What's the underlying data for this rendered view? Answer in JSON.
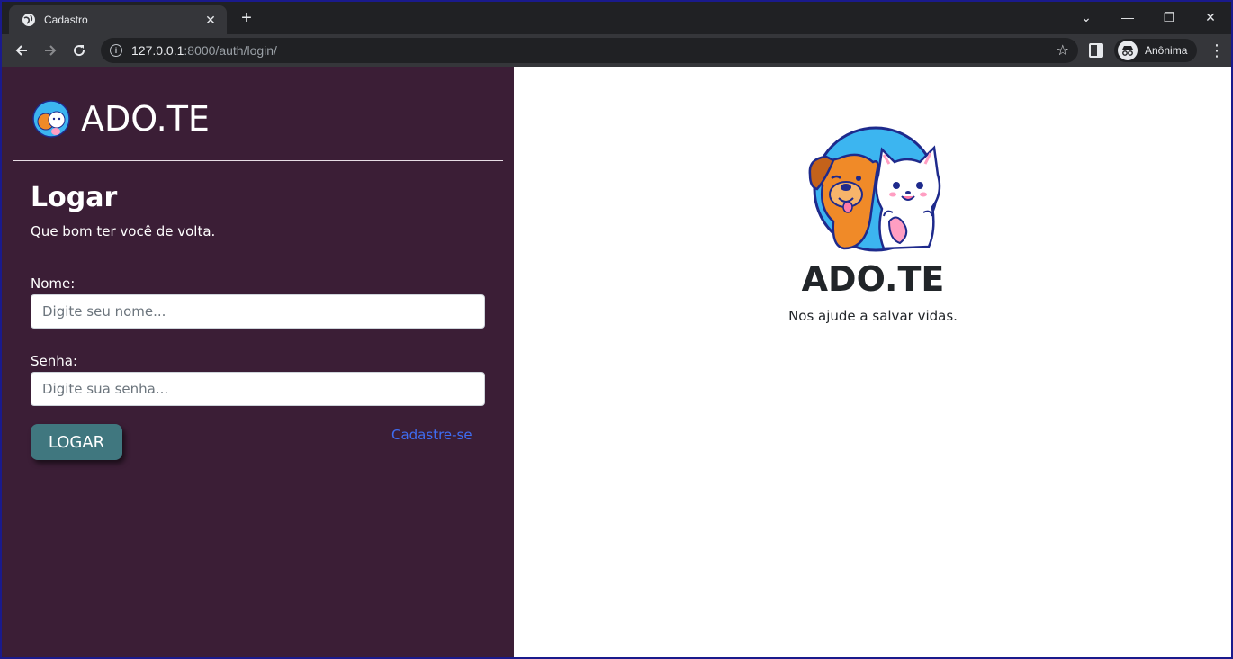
{
  "browser": {
    "tab_title": "Cadastro",
    "tab_close": "✕",
    "new_tab": "+",
    "url_host": "127.0.0.1",
    "url_rest": ":8000/auth/login/",
    "profile_label": "Anônima",
    "window_controls": {
      "dropdown": "⌄",
      "minimize": "—",
      "restore": "❐",
      "close": "✕"
    },
    "icons": [
      "globe-icon",
      "back-icon",
      "forward-icon",
      "reload-icon",
      "info-icon",
      "star-icon",
      "side-panel-icon",
      "incognito-icon",
      "kebab-menu-icon"
    ]
  },
  "sidebar": {
    "brand": "ADO.TE",
    "heading": "Logar",
    "subtitle": "Que bom ter você de volta.",
    "name_label": "Nome:",
    "name_placeholder": "Digite seu nome...",
    "password_label": "Senha:",
    "password_placeholder": "Digite sua senha...",
    "login_button": "LOGAR",
    "register_link": "Cadastre-se"
  },
  "hero": {
    "title": "ADO.TE",
    "subtitle": "Nos ajude a salvar vidas."
  },
  "colors": {
    "sidebar_bg": "#3b1e36",
    "button_bg": "#40777f",
    "link": "#3f6df2",
    "logo_ring": "#1e2a8c",
    "logo_sky": "#3cb5f0",
    "dog": "#f08a28",
    "cat": "#ffffff"
  }
}
